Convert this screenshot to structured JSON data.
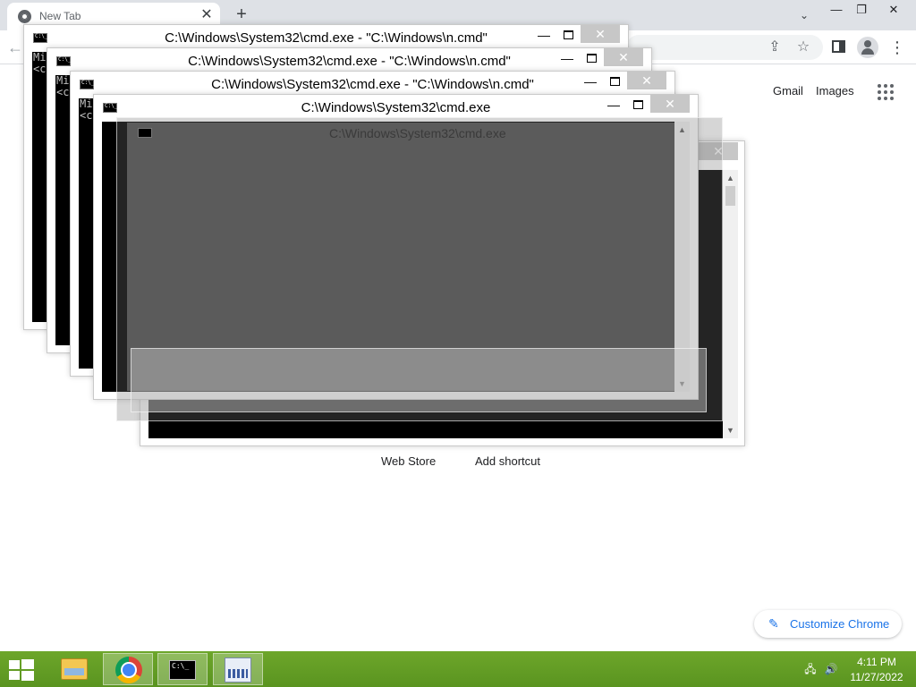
{
  "browser": {
    "tab": {
      "title": "New Tab",
      "close": "✕"
    },
    "new_tab": "+",
    "tab_search": "⌄",
    "window_controls": {
      "minimize": "—",
      "restore": "❐",
      "close": "✕"
    },
    "toolbar": {
      "back": "←",
      "share": "⇪",
      "bookmark": "☆",
      "menu": "⋮"
    },
    "top_links": {
      "gmail": "Gmail",
      "images": "Images"
    },
    "shortcuts": {
      "web_store": "Web Store",
      "add_shortcut": "Add shortcut"
    },
    "customize": {
      "label": "Customize Chrome",
      "icon": "✎"
    }
  },
  "cmd_windows": [
    {
      "title": "C:\\Windows\\System32\\cmd.exe - \"C:\\Windows\\n.cmd\"",
      "console_text": "Mi\n<c",
      "close": "✕"
    },
    {
      "title": "C:\\Windows\\System32\\cmd.exe - \"C:\\Windows\\n.cmd\"",
      "console_text": "Mi\n<c",
      "close": "✕"
    },
    {
      "title": "C:\\Windows\\System32\\cmd.exe - \"C:\\Windows\\n.cmd\"",
      "console_text": "Mi\n<c",
      "close": "✕"
    },
    {
      "title": "C:\\Windows\\System32\\cmd.exe",
      "close": "✕"
    }
  ],
  "ghost_window": {
    "title": "C:\\Windows\\System32\\cmd.exe",
    "close": "✕"
  },
  "scroll": {
    "up": "▲",
    "down": "▼"
  },
  "window_buttons": {
    "minimize": "—"
  },
  "taskbar": {
    "clock_time": "4:11 PM",
    "clock_date": "11/27/2022",
    "tray": {
      "network": "🖧",
      "volume": "🔊"
    }
  },
  "colors": {
    "taskbar": "#5f9a24",
    "link_blue": "#1a73e8",
    "console_bg": "#000000"
  }
}
